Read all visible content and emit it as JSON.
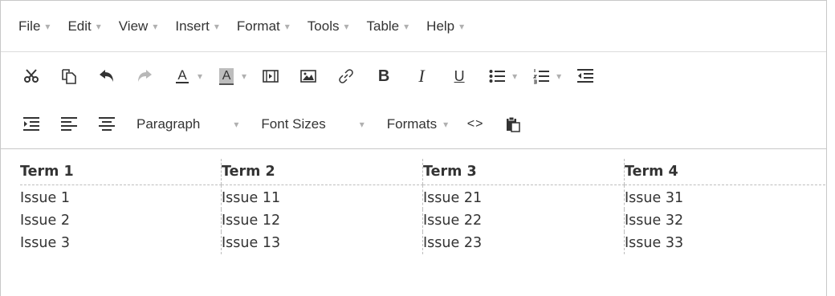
{
  "menubar": {
    "items": [
      {
        "label": "File"
      },
      {
        "label": "Edit"
      },
      {
        "label": "View"
      },
      {
        "label": "Insert"
      },
      {
        "label": "Format"
      },
      {
        "label": "Tools"
      },
      {
        "label": "Table"
      },
      {
        "label": "Help"
      }
    ]
  },
  "toolbar": {
    "block_format": "Paragraph",
    "font_sizes": "Font Sizes",
    "formats": "Formats",
    "text_color_letter": "A",
    "bg_color_letter": "A",
    "bold_glyph": "B",
    "italic_glyph": "I",
    "underline_glyph": "U",
    "code_glyph": "<>",
    "caret": "▾",
    "icons": [
      "cut-icon",
      "copy-icon",
      "undo-icon",
      "redo-icon",
      "text-color-icon",
      "background-color-icon",
      "media-icon",
      "image-icon",
      "link-icon",
      "bold-icon",
      "italic-icon",
      "underline-icon",
      "bullet-list-icon",
      "numbered-list-icon",
      "outdent-icon",
      "indent-icon",
      "align-left-icon",
      "align-center-icon",
      "code-icon",
      "paste-icon"
    ]
  },
  "table": {
    "headers": [
      "Term 1",
      "Term 2",
      "Term 3",
      "Term 4"
    ],
    "rows": [
      [
        "Issue 1",
        "Issue 11",
        "Issue 21",
        "Issue 31"
      ],
      [
        "Issue 2",
        "Issue 12",
        "Issue 22",
        "Issue 32"
      ],
      [
        "Issue 3",
        "Issue 13",
        "Issue 23",
        "Issue 33"
      ]
    ]
  }
}
